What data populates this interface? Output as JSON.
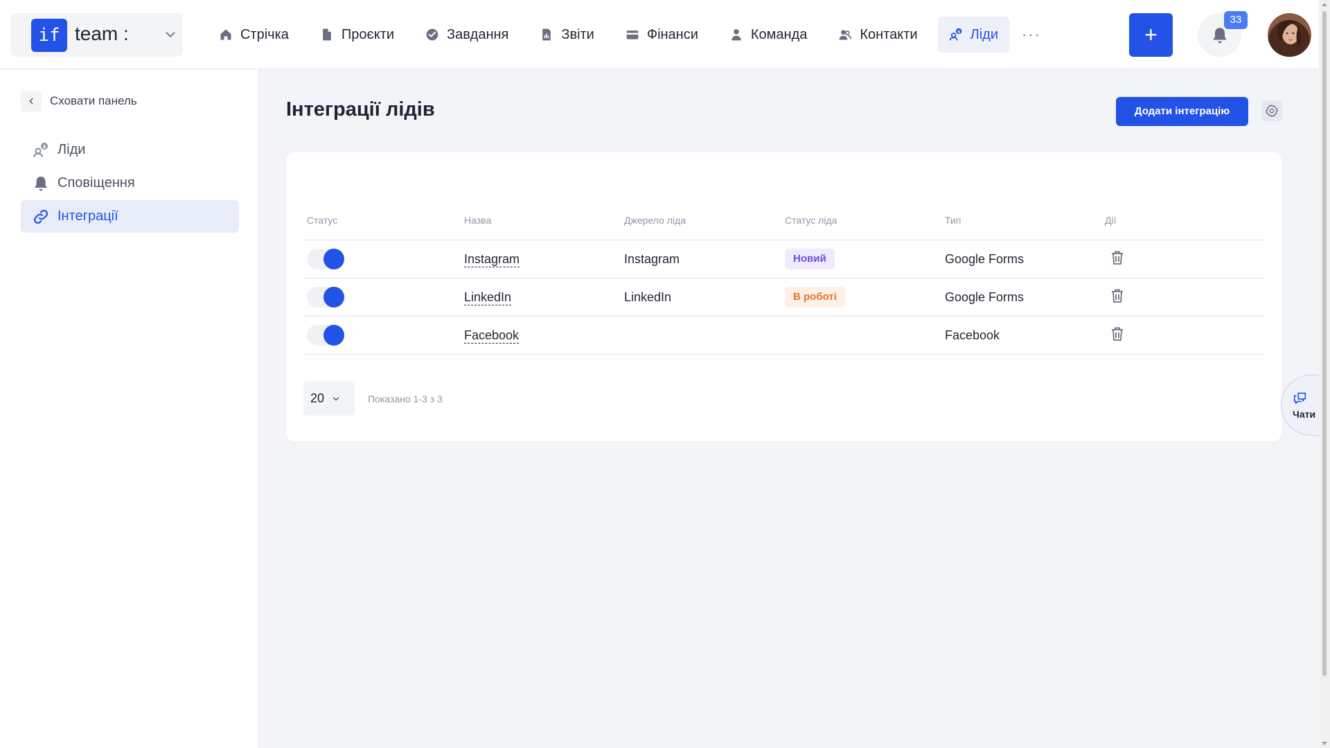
{
  "header": {
    "logo_text": "if",
    "team_name": "team :",
    "nav": [
      {
        "label": "Стрічка",
        "icon": "home-icon"
      },
      {
        "label": "Проєкти",
        "icon": "document-icon"
      },
      {
        "label": "Завдання",
        "icon": "check-circle-icon"
      },
      {
        "label": "Звіти",
        "icon": "report-icon"
      },
      {
        "label": "Фінанси",
        "icon": "wallet-icon"
      },
      {
        "label": "Команда",
        "icon": "user-icon"
      },
      {
        "label": "Контакти",
        "icon": "contacts-icon"
      },
      {
        "label": "Ліди",
        "icon": "leads-icon"
      }
    ],
    "more_label": "···",
    "plus_label": "+",
    "notifications_count": "33"
  },
  "sidebar": {
    "hide_label": "Сховати панель",
    "items": [
      {
        "label": "Ліди",
        "icon": "leads-icon"
      },
      {
        "label": "Сповіщення",
        "icon": "bell-icon"
      },
      {
        "label": "Інтеграції",
        "icon": "link-icon"
      }
    ]
  },
  "main": {
    "title": "Інтеграції лідів",
    "add_button": "Додати інтеграцію"
  },
  "table": {
    "columns": [
      "Статус",
      "Назва",
      "Джерело ліда",
      "Статус ліда",
      "Тип",
      "Дії"
    ],
    "rows": [
      {
        "enabled": true,
        "name": "Instagram",
        "source": "Instagram",
        "lead_status": "Новий",
        "type": "Google Forms"
      },
      {
        "enabled": true,
        "name": "LinkedIn",
        "source": "LinkedIn",
        "lead_status": "В роботі",
        "type": "Google Forms"
      },
      {
        "enabled": true,
        "name": "Facebook",
        "source": "",
        "lead_status": "",
        "type": "Facebook"
      }
    ]
  },
  "pagination": {
    "per_page": "20",
    "info": "Показано 1-3 з 3"
  },
  "chats": {
    "label": "Чати"
  },
  "colors": {
    "accent": "#2353e6",
    "badge_new": "#6b4fd8",
    "badge_work": "#e7742b"
  }
}
